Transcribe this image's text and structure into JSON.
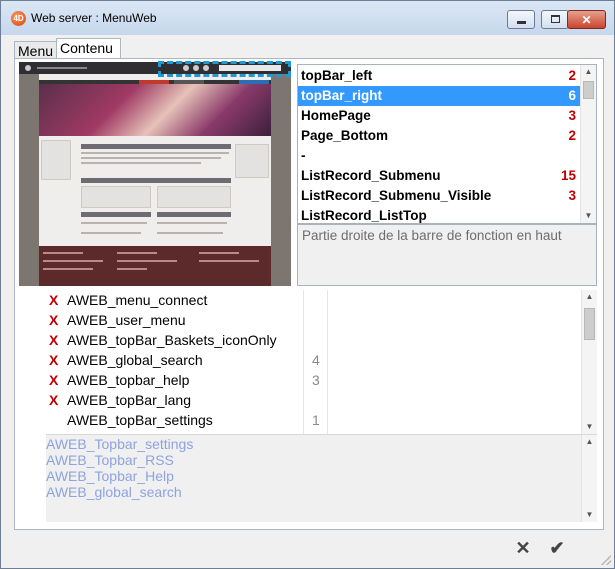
{
  "window": {
    "title": "Web server : MenuWeb",
    "app_icon": "4D"
  },
  "controls": {
    "minimize": "minimize-icon",
    "maximize": "maximize-icon",
    "close": "✕"
  },
  "tabs": [
    {
      "label": "Menu"
    },
    {
      "label": "Contenu"
    }
  ],
  "slots": {
    "items": [
      {
        "name": "topBar_left",
        "count": "2"
      },
      {
        "name": "topBar_right",
        "count": "6",
        "selected": true
      },
      {
        "name": "HomePage",
        "count": "3"
      },
      {
        "name": "Page_Bottom",
        "count": "2"
      },
      {
        "name": "-",
        "count": ""
      },
      {
        "name": "ListRecord_Submenu",
        "count": "15"
      },
      {
        "name": "ListRecord_Submenu_Visible",
        "count": "3"
      },
      {
        "name": "ListRecord_ListTop",
        "count": ""
      }
    ],
    "description": "Partie droite de la barre de fonction en haut"
  },
  "components": [
    {
      "name": "AWEB_menu_connect",
      "removed": true,
      "num": ""
    },
    {
      "name": "AWEB_user_menu",
      "removed": true,
      "num": ""
    },
    {
      "name": "AWEB_topBar_Baskets_iconOnly",
      "removed": true,
      "num": ""
    },
    {
      "name": "AWEB_global_search",
      "removed": true,
      "num": "4"
    },
    {
      "name": "AWEB_topbar_help",
      "removed": true,
      "num": "3"
    },
    {
      "name": "AWEB_topBar_lang",
      "removed": true,
      "num": ""
    },
    {
      "name": "AWEB_topBar_settings",
      "removed": false,
      "num": "1"
    }
  ],
  "remove_mark": "X",
  "available": [
    "AWEB_Topbar_settings",
    "AWEB_Topbar_RSS",
    "AWEB_Topbar_Help",
    "AWEB_global_search"
  ],
  "footer": {
    "cancel": "✕",
    "ok": "✔"
  },
  "colors": {
    "selection": "#3399ff",
    "count": "#c00000",
    "dashed_highlight": "#1e9bd7",
    "available_text": "#8ea3e0"
  }
}
